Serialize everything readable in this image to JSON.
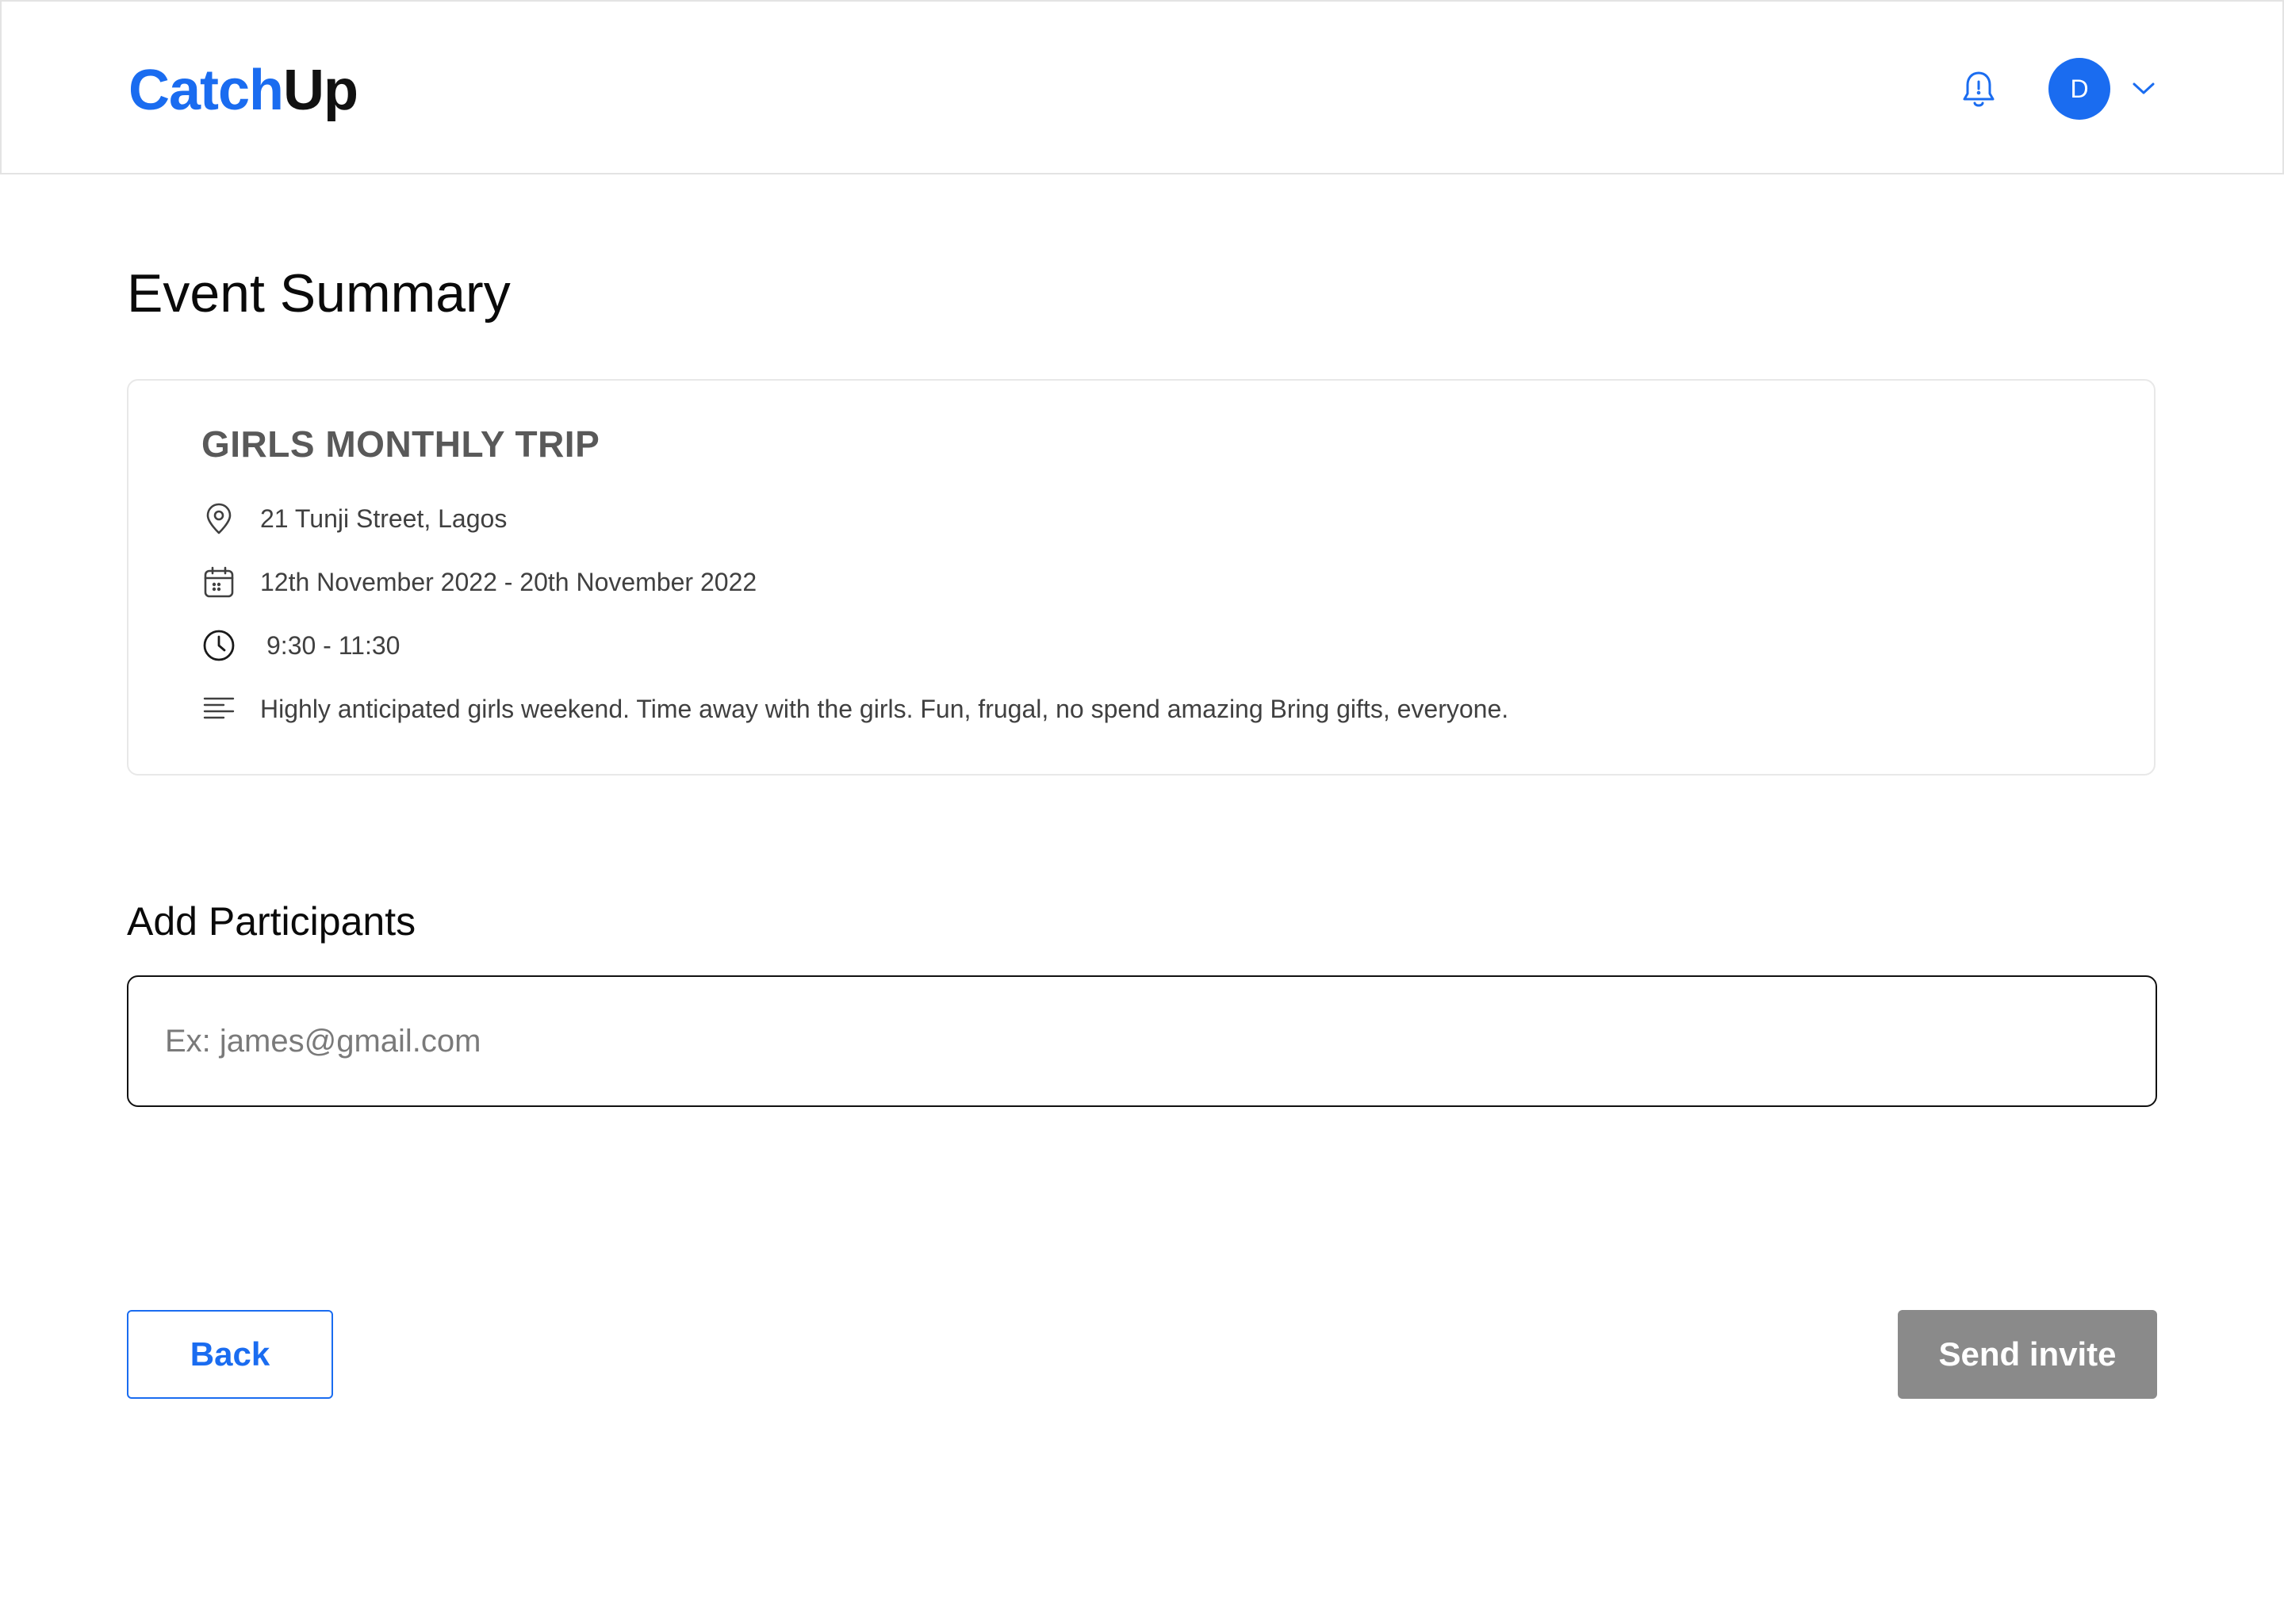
{
  "app": {
    "logo_part1": "Catch",
    "logo_part2": "Up",
    "brand_color": "#1a6cf0",
    "user_initial": "D"
  },
  "header": {
    "icons": [
      "bell-icon",
      "avatar",
      "chevron-down-icon"
    ]
  },
  "page": {
    "title": "Event Summary"
  },
  "event": {
    "name": "GIRLS MONTHLY TRIP",
    "location": "21 Tunji Street, Lagos",
    "dates": "12th November 2022 - 20th November 2022",
    "time": "9:30 - 11:30",
    "description": "Highly anticipated girls weekend. Time away with the girls. Fun, frugal, no spend amazing Bring gifts, everyone.",
    "icons": [
      "location-pin-icon",
      "calendar-icon",
      "clock-icon",
      "text-lines-icon"
    ]
  },
  "participants": {
    "label": "Add Participants",
    "placeholder": "Ex: james@gmail.com",
    "value": ""
  },
  "actions": {
    "back_label": "Back",
    "send_label": "Send invite",
    "send_color": "#8a8a8a"
  }
}
